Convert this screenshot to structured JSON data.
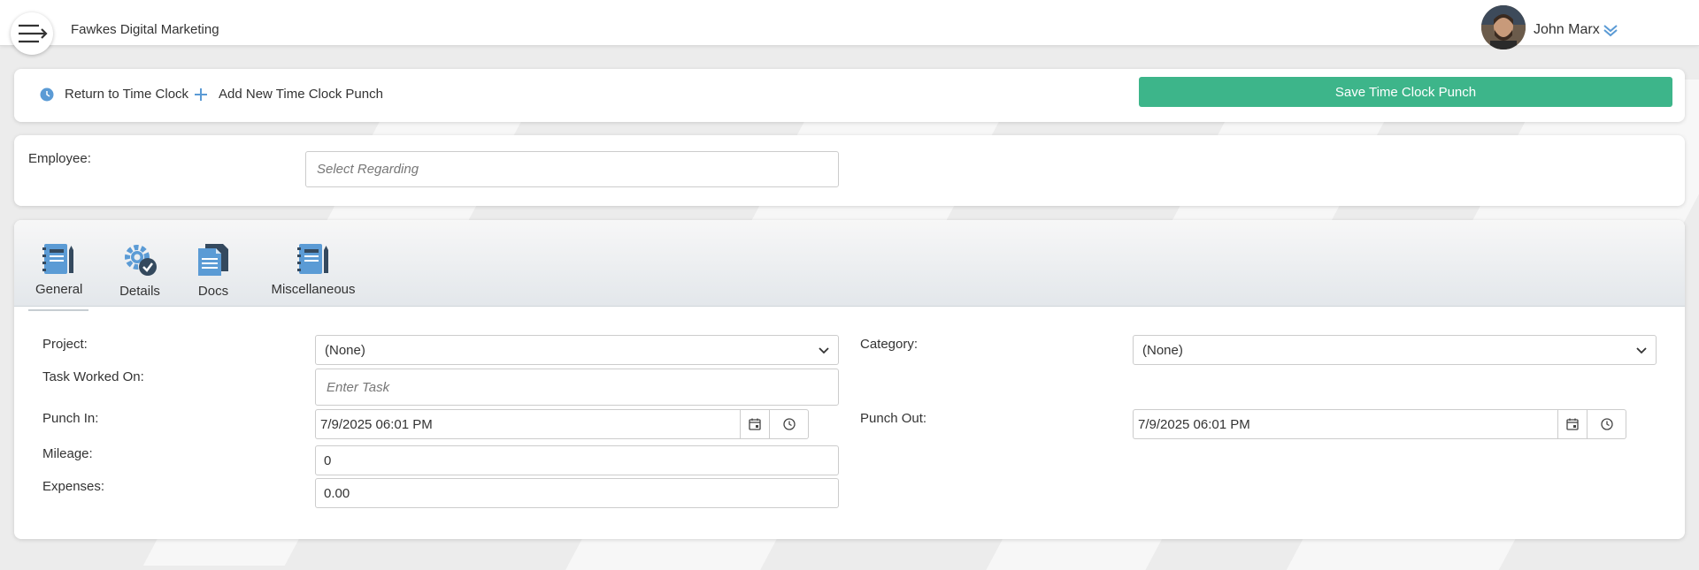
{
  "header": {
    "company": "Fawkes Digital Marketing",
    "user_name": "John Marx"
  },
  "toolbar": {
    "return_label": "Return to Time Clock",
    "add_label": "Add New Time Clock Punch",
    "save_label": "Save Time Clock Punch"
  },
  "employee": {
    "label": "Employee:",
    "placeholder": "Select Regarding"
  },
  "tabs": [
    {
      "label": "General"
    },
    {
      "label": "Details"
    },
    {
      "label": "Docs"
    },
    {
      "label": "Miscellaneous"
    }
  ],
  "form": {
    "project_label": "Project:",
    "project_value": "(None)",
    "category_label": "Category:",
    "category_value": "(None)",
    "task_label": "Task Worked On:",
    "task_placeholder": "Enter Task",
    "punch_in_label": "Punch In:",
    "punch_in_value": "7/9/2025 06:01 PM",
    "punch_out_label": "Punch Out:",
    "punch_out_value": "7/9/2025 06:01 PM",
    "mileage_label": "Mileage:",
    "mileage_value": "0",
    "expenses_label": "Expenses:",
    "expenses_value": "0.00"
  },
  "colors": {
    "accent_green": "#3db58a",
    "icon_blue": "#5b9bd5"
  }
}
